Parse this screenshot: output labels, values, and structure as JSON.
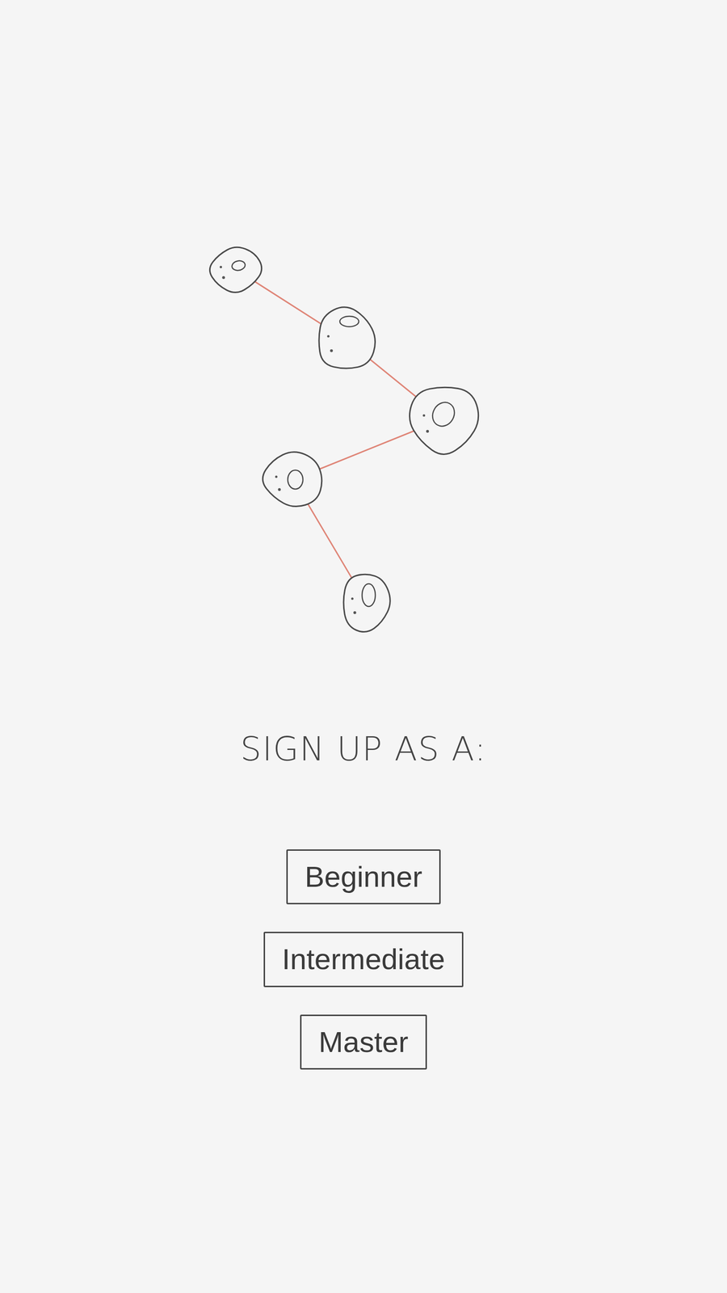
{
  "route": {
    "holds": 5,
    "links": [
      [
        0,
        1
      ],
      [
        1,
        2
      ],
      [
        2,
        3
      ],
      [
        3,
        4
      ]
    ]
  },
  "heading": "SIGN UP AS A:",
  "options": [
    {
      "label": "Beginner",
      "selected": false
    },
    {
      "label": "Intermediate",
      "selected": false
    },
    {
      "label": "Master",
      "selected": false
    }
  ]
}
